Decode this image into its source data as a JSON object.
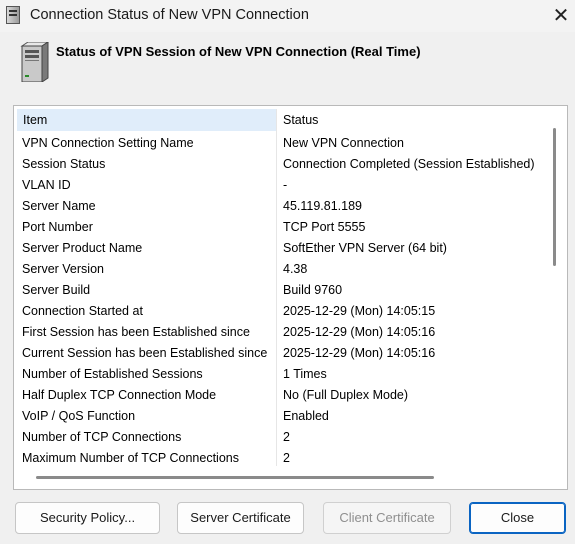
{
  "window": {
    "title": "Connection Status of New VPN Connection",
    "close_glyph": "✕"
  },
  "header": {
    "title": "Status of VPN Session of New VPN Connection (Real Time)",
    "icon": "server-icon"
  },
  "table": {
    "columns": [
      "Item",
      "Status"
    ],
    "rows": [
      [
        "VPN Connection Setting Name",
        "New VPN Connection"
      ],
      [
        "Session Status",
        "Connection Completed (Session Established)"
      ],
      [
        "VLAN ID",
        "-"
      ],
      [
        "Server Name",
        "45.119.81.189"
      ],
      [
        "Port Number",
        "TCP Port 5555"
      ],
      [
        "Server Product Name",
        "SoftEther VPN Server (64 bit)"
      ],
      [
        "Server Version",
        "4.38"
      ],
      [
        "Server Build",
        "Build 9760"
      ],
      [
        "Connection Started at",
        "2025-12-29 (Mon) 14:05:15"
      ],
      [
        "First Session has been Established since",
        "2025-12-29 (Mon) 14:05:16"
      ],
      [
        "Current Session has been Established since",
        "2025-12-29 (Mon) 14:05:16"
      ],
      [
        "Number of Established Sessions",
        "1 Times"
      ],
      [
        "Half Duplex TCP Connection Mode",
        "No (Full Duplex Mode)"
      ],
      [
        "VoIP / QoS Function",
        "Enabled"
      ],
      [
        "Number of TCP Connections",
        "2"
      ],
      [
        "Maximum Number of TCP Connections",
        "2"
      ]
    ]
  },
  "buttons": {
    "security_policy": "Security Policy...",
    "server_certificate": "Server Certificate",
    "client_certificate": "Client Certificate",
    "close": "Close"
  },
  "colors": {
    "header_highlight": "#e0edfa",
    "default_button_border": "#0a64c2"
  }
}
